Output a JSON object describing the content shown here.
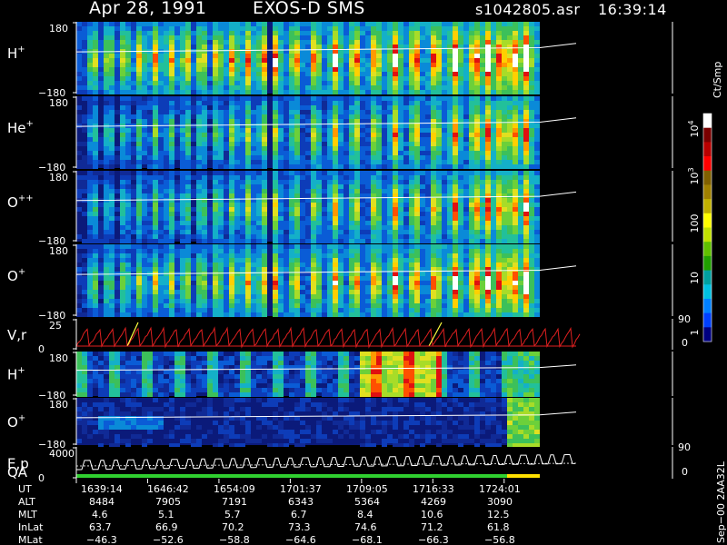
{
  "header": {
    "date": "Apr 28, 1991",
    "mission": "EXOS-D SMS",
    "file": "s1042805.asr",
    "time": "16:39:14"
  },
  "colorbar": {
    "label": "Ct/Smp",
    "ticks": [
      "10",
      "10",
      "100",
      "10",
      "1"
    ],
    "tick_exponents": [
      "4",
      "3",
      "",
      "",
      ""
    ],
    "colors": [
      "#ffffff",
      "#7a0000",
      "#b80000",
      "#ff0000",
      "#806000",
      "#a08000",
      "#c0b000",
      "#ffff00",
      "#c0e000",
      "#60c000",
      "#20a000",
      "#00a0a0",
      "#00c0e0",
      "#0080ff",
      "#0040ff",
      "#000080"
    ]
  },
  "panels": [
    {
      "id": "h-plus",
      "label": "H",
      "sup": "+",
      "ymax": "180",
      "ymin": "−180"
    },
    {
      "id": "he-plus",
      "label": "He",
      "sup": "+",
      "ymax": "180",
      "ymin": "−180"
    },
    {
      "id": "o-plusplus",
      "label": "O",
      "sup": "++",
      "ymax": "180",
      "ymin": "−180"
    },
    {
      "id": "o-plus",
      "label": "O",
      "sup": "+",
      "ymax": "180",
      "ymin": "−180"
    },
    {
      "id": "vr",
      "label": "V,r",
      "sup": "",
      "ymax": "25",
      "ymin": "0",
      "right_max": "90",
      "right_min": "0"
    },
    {
      "id": "h-plus-2",
      "label": "H",
      "sup": "+",
      "ymax": "180",
      "ymin": "−180"
    },
    {
      "id": "o-plus-2",
      "label": "O",
      "sup": "+",
      "ymax": "180",
      "ymin": "−180"
    },
    {
      "id": "ep",
      "label": "E,p",
      "sup": "",
      "label2": "QA",
      "ymax": "4000",
      "ymin": "0",
      "right_max": "90",
      "right_min": "0"
    }
  ],
  "chart_data": {
    "type": "heatmap",
    "title": "Apr 28, 1991   EXOS-D SMS",
    "x_axis": {
      "label": "UT",
      "ticks": [
        "1639:14",
        "1646:42",
        "1654:09",
        "1701:37",
        "1709:05",
        "1716:33",
        "1724:01"
      ]
    },
    "ephemeris": [
      {
        "name": "UT",
        "values": [
          "1639:14",
          "1646:42",
          "1654:09",
          "1701:37",
          "1709:05",
          "1716:33",
          "1724:01"
        ]
      },
      {
        "name": "ALT",
        "values": [
          "8484",
          "7905",
          "7191",
          "6343",
          "5364",
          "4269",
          "3090"
        ]
      },
      {
        "name": "MLT",
        "values": [
          "4.6",
          "5.1",
          "5.7",
          "6.7",
          "8.4",
          "10.6",
          "12.5"
        ]
      },
      {
        "name": "InLat",
        "values": [
          "63.7",
          "66.9",
          "70.2",
          "73.3",
          "74.6",
          "71.2",
          "61.8"
        ]
      },
      {
        "name": "MLat",
        "values": [
          "−46.3",
          "−52.6",
          "−58.8",
          "−64.6",
          "−68.1",
          "−66.3",
          "−56.8"
        ]
      }
    ],
    "colorbar_range": [
      1,
      10000
    ],
    "colorbar_scale": "log"
  },
  "footer": {
    "side_label": "Sep−00  2AA32L"
  }
}
